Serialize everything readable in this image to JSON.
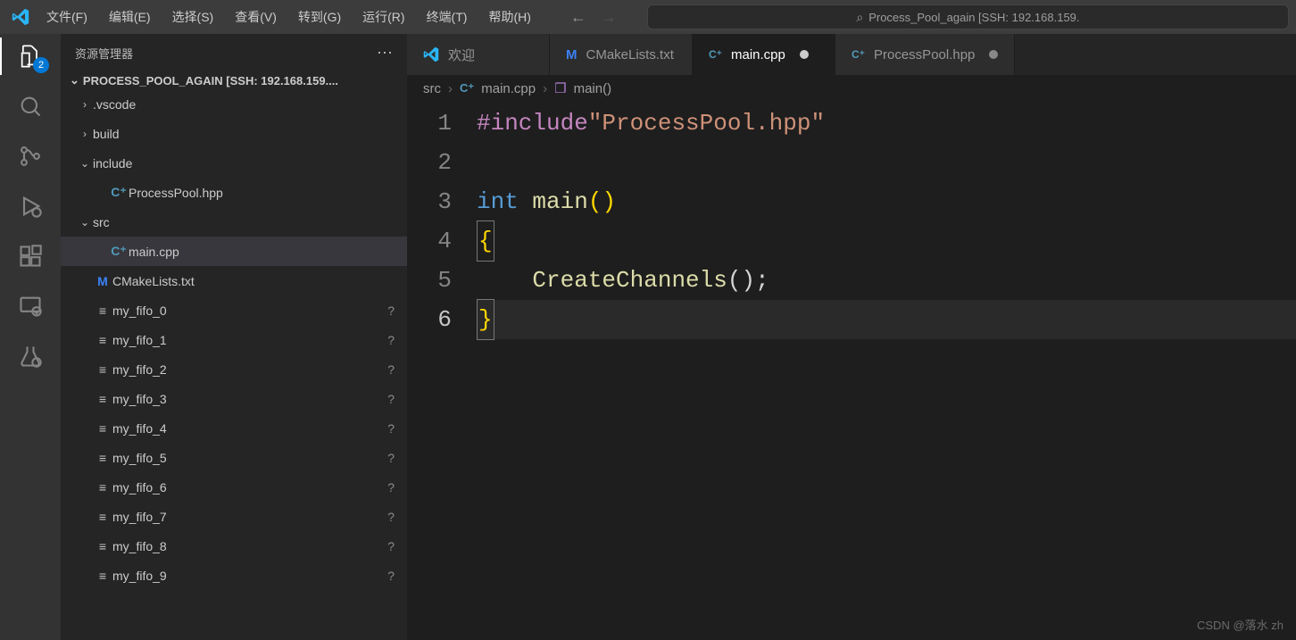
{
  "menu": {
    "file": "文件(F)",
    "edit": "编辑(E)",
    "selection": "选择(S)",
    "view": "查看(V)",
    "go": "转到(G)",
    "run": "运行(R)",
    "terminal": "终端(T)",
    "help": "帮助(H)"
  },
  "search_placeholder": "Process_Pool_again [SSH: 192.168.159.",
  "activity": {
    "explorer_badge": "2"
  },
  "sidebar": {
    "title": "资源管理器",
    "project": "PROCESS_POOL_AGAIN [SSH: 192.168.159....",
    "folders": {
      "vscode": ".vscode",
      "build": "build",
      "include": "include",
      "processpool": "ProcessPool.hpp",
      "src": "src",
      "main": "main.cpp",
      "cmake": "CMakeLists.txt"
    },
    "fifos": [
      "my_fifo_0",
      "my_fifo_1",
      "my_fifo_2",
      "my_fifo_3",
      "my_fifo_4",
      "my_fifo_5",
      "my_fifo_6",
      "my_fifo_7",
      "my_fifo_8",
      "my_fifo_9"
    ],
    "status_unknown": "?"
  },
  "tabs": {
    "welcome": "欢迎",
    "cmake": "CMakeLists.txt",
    "main": "main.cpp",
    "processpool": "ProcessPool.hpp"
  },
  "breadcrumbs": {
    "src": "src",
    "main": "main.cpp",
    "func": "main()"
  },
  "code": {
    "l1_pre": "#include",
    "l1_str": "\"ProcessPool.hpp\"",
    "l3_kw": "int",
    "l3_fn": "main",
    "l3_paren": "()",
    "l4": "{",
    "l5_indent": "    ",
    "l5_fn": "CreateChannels",
    "l5_rest": "();",
    "l6": "}"
  },
  "line_numbers": [
    "1",
    "2",
    "3",
    "4",
    "5",
    "6"
  ],
  "watermark": "CSDN @落水 zh"
}
